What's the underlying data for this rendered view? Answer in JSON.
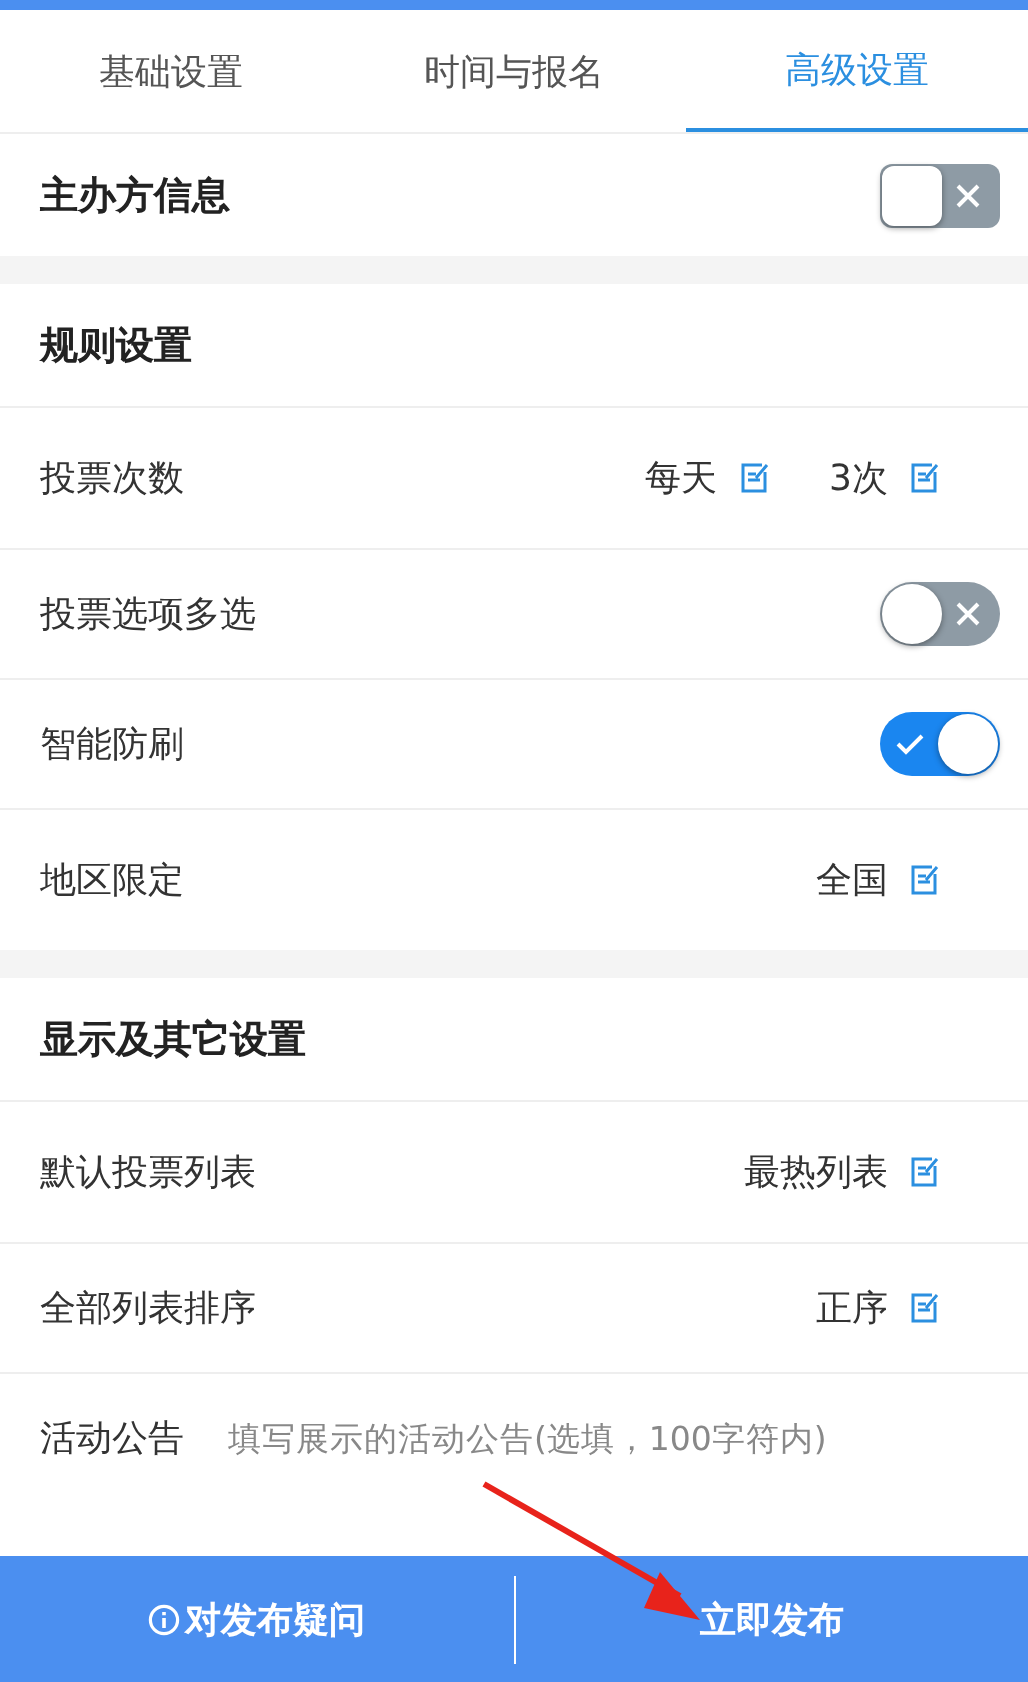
{
  "tabs": [
    {
      "label": "基础设置",
      "selected": false
    },
    {
      "label": "时间与报名",
      "selected": false
    },
    {
      "label": "高级设置",
      "selected": true
    }
  ],
  "sections": [
    {
      "title": "主办方信息",
      "toggle": {
        "on": false
      }
    },
    {
      "title": "规则设置",
      "rows": [
        {
          "kind": "values",
          "label": "投票次数",
          "values": [
            "每天",
            "3次"
          ]
        },
        {
          "kind": "toggle",
          "label": "投票选项多选",
          "on": false
        },
        {
          "kind": "toggle",
          "label": "智能防刷",
          "on": true
        },
        {
          "kind": "values",
          "label": "地区限定",
          "values": [
            "全国"
          ]
        }
      ]
    },
    {
      "title": "显示及其它设置",
      "rows": [
        {
          "kind": "values",
          "label": "默认投票列表",
          "values": [
            "最热列表"
          ]
        },
        {
          "kind": "values",
          "label": "全部列表排序",
          "values": [
            "正序"
          ]
        },
        {
          "kind": "field",
          "label": "活动公告",
          "placeholder": "填写展示的活动公告(选填，100字符内)"
        }
      ]
    }
  ],
  "footer": {
    "help_button": "对发布疑问",
    "publish_button": "立即发布"
  }
}
